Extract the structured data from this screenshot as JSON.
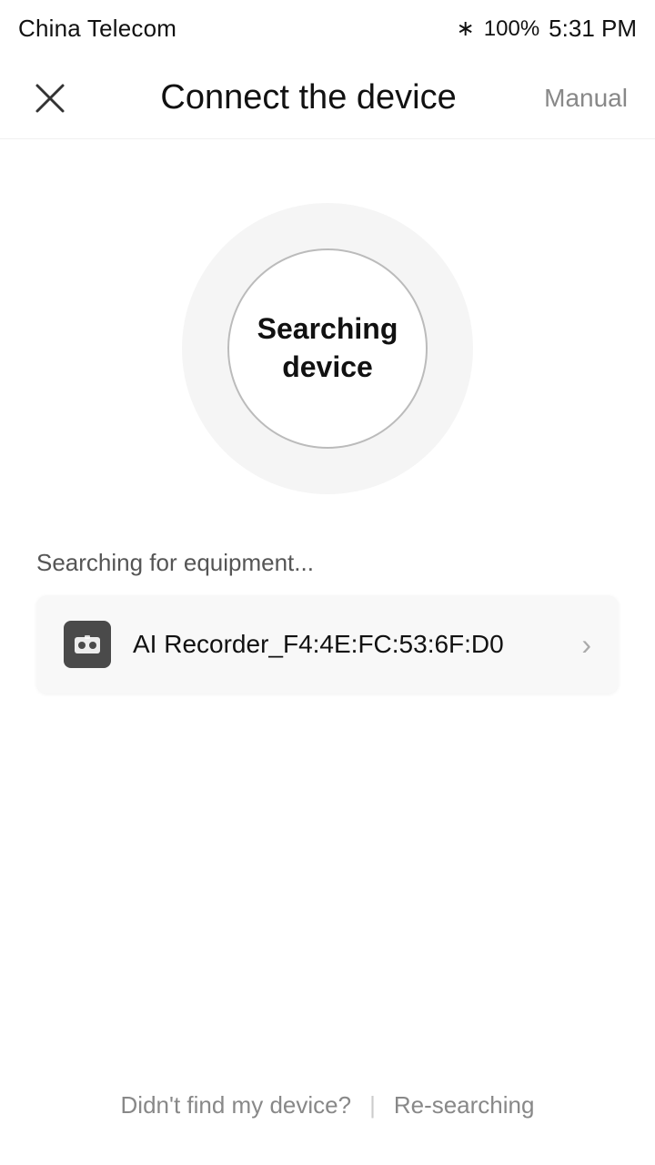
{
  "statusBar": {
    "carrier": "China Telecom",
    "time": "5:31 PM",
    "battery": "100%"
  },
  "header": {
    "title": "Connect the device",
    "manual_label": "Manual",
    "close_label": "Close"
  },
  "searchCircle": {
    "line1": "Searching",
    "line2": "device"
  },
  "searchingLabel": "Searching for equipment...",
  "deviceItem": {
    "name": "AI Recorder_F4:4E:FC:53:6F:D0"
  },
  "footer": {
    "notFound": "Didn't find my device?",
    "divider": "|",
    "reSearch": "Re-searching"
  }
}
